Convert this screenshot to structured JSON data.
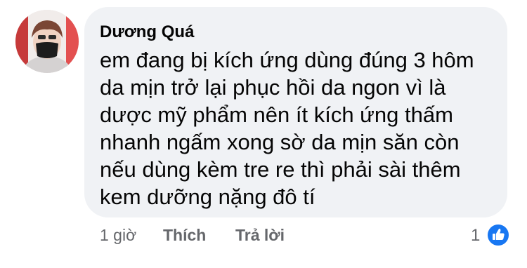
{
  "comment": {
    "author": "Dương Quá",
    "lines": [
      "em đang bị kích ứng dùng đúng 3 hôm",
      "da mịn trở lại phục hồi da ngon vì là",
      "dược mỹ phẩm nên ít kích ứng thấm",
      "nhanh ngấm xong sờ da mịn săn còn",
      "nếu dùng kèm tre re thì phải sài thêm",
      "kem dưỡng nặng đô tí"
    ]
  },
  "actions": {
    "time": "1 giờ",
    "like_label": "Thích",
    "reply_label": "Trả lời"
  },
  "reactions": {
    "count": "1",
    "icon": "like-icon"
  },
  "colors": {
    "bubble": "#f0f2f5",
    "text": "#050505",
    "secondary_text": "#65676b",
    "like_blue": "#1877f2"
  }
}
